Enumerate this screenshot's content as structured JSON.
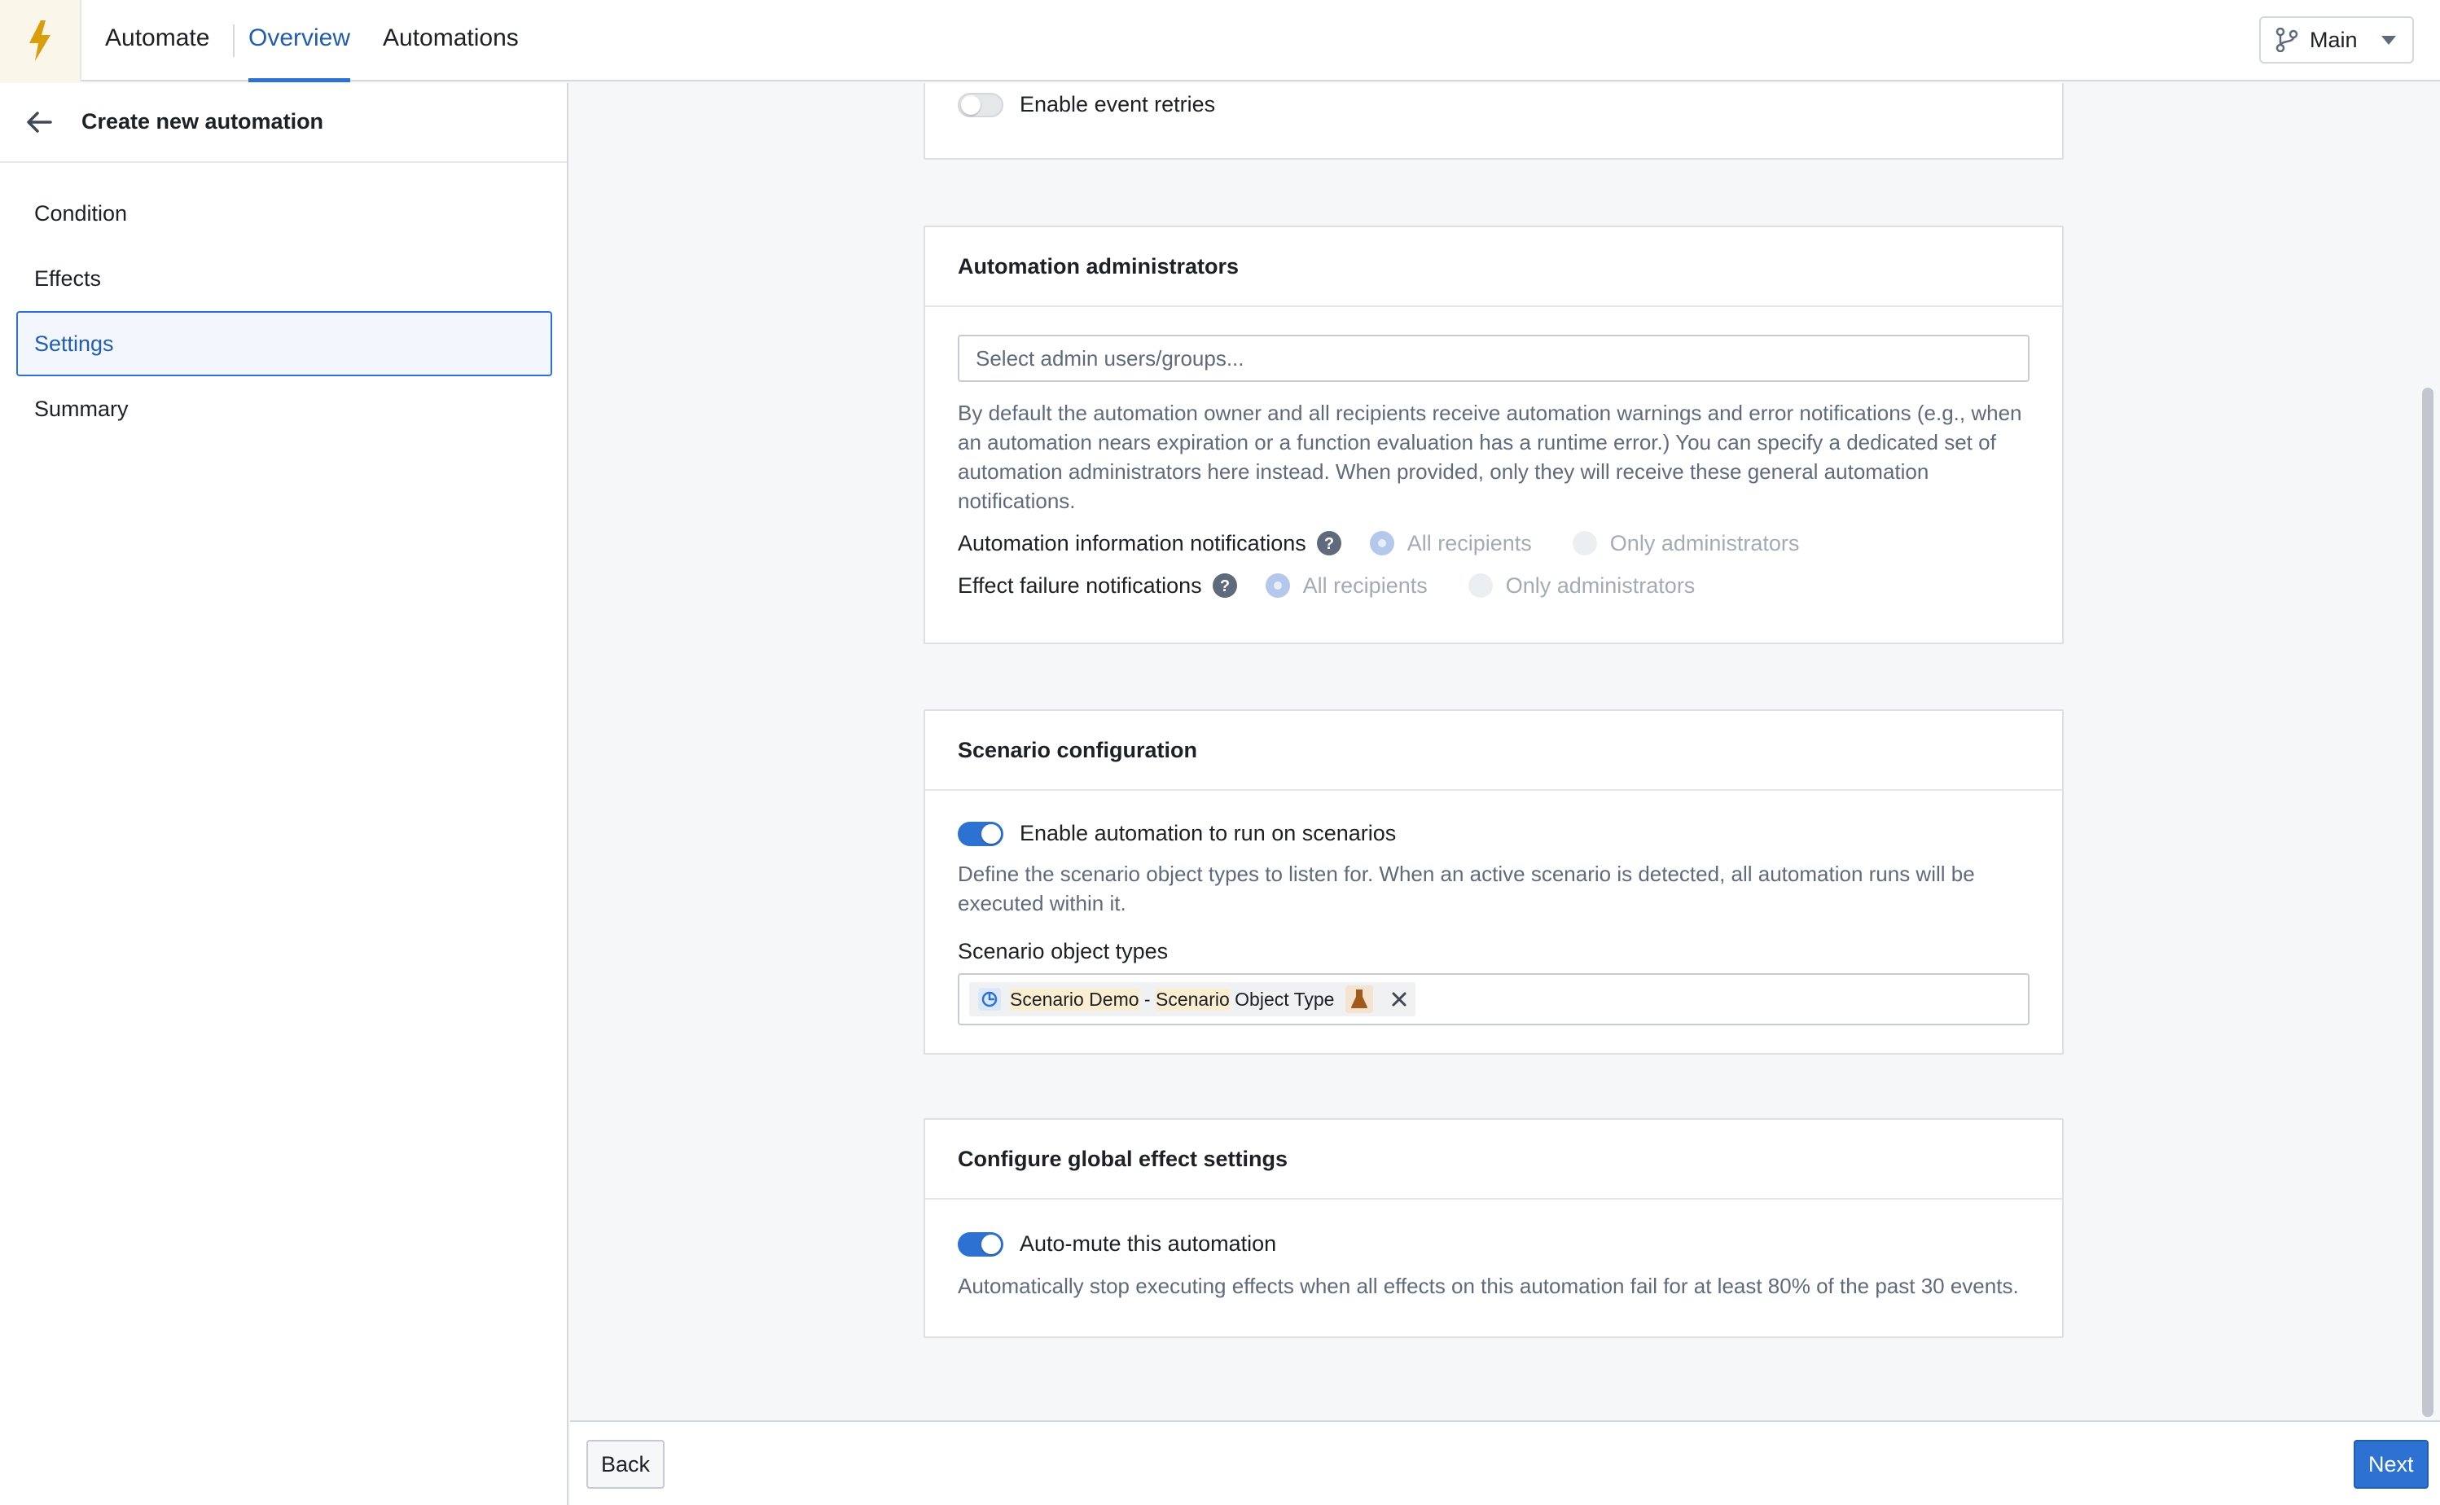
{
  "topbar": {
    "app_name": "Automate",
    "tabs": [
      {
        "label": "Overview",
        "active": true
      },
      {
        "label": "Automations",
        "active": false
      }
    ],
    "branch": {
      "label": "Main",
      "icon": "git-branch-icon"
    },
    "logo_icon": "lightning-bolt-icon"
  },
  "sidebar": {
    "title": "Create new automation",
    "items": [
      {
        "label": "Condition"
      },
      {
        "label": "Effects"
      },
      {
        "label": "Settings",
        "active": true
      },
      {
        "label": "Summary"
      }
    ]
  },
  "retries": {
    "toggle_label": "Enable event retries",
    "enabled": false
  },
  "admins": {
    "title": "Automation administrators",
    "placeholder": "Select admin users/groups...",
    "description": "By default the automation owner and all recipients receive automation warnings and error notifications (e.g., when an automation nears expiration or a function evaluation has a runtime error.) You can specify a dedicated set of automation administrators here instead. When provided, only they will receive these general automation notifications.",
    "rows": [
      {
        "label": "Automation information notifications",
        "opt1": "All recipients",
        "opt2": "Only administrators",
        "selected": "All recipients"
      },
      {
        "label": "Effect failure notifications",
        "opt1": "All recipients",
        "opt2": "Only administrators",
        "selected": "All recipients"
      }
    ]
  },
  "scenario": {
    "title": "Scenario configuration",
    "toggle_label": "Enable automation to run on scenarios",
    "enabled": true,
    "description": "Define the scenario object types to listen for. When an active scenario is detected, all automation runs will be executed within it.",
    "field_label": "Scenario object types",
    "tag": {
      "part1": "Scenario Demo",
      "sep": " - ",
      "part2": "Scenario",
      "part3": " Object Type"
    }
  },
  "global": {
    "title": "Configure global effect settings",
    "toggle_label": "Auto-mute this automation",
    "enabled": true,
    "description": "Automatically stop executing effects when all effects on this automation fail for at least 80% of the past 30 events."
  },
  "footer": {
    "back_label": "Back",
    "next_label": "Next"
  },
  "colors": {
    "accent": "#2d72d2",
    "logo": "#d99e0b"
  }
}
